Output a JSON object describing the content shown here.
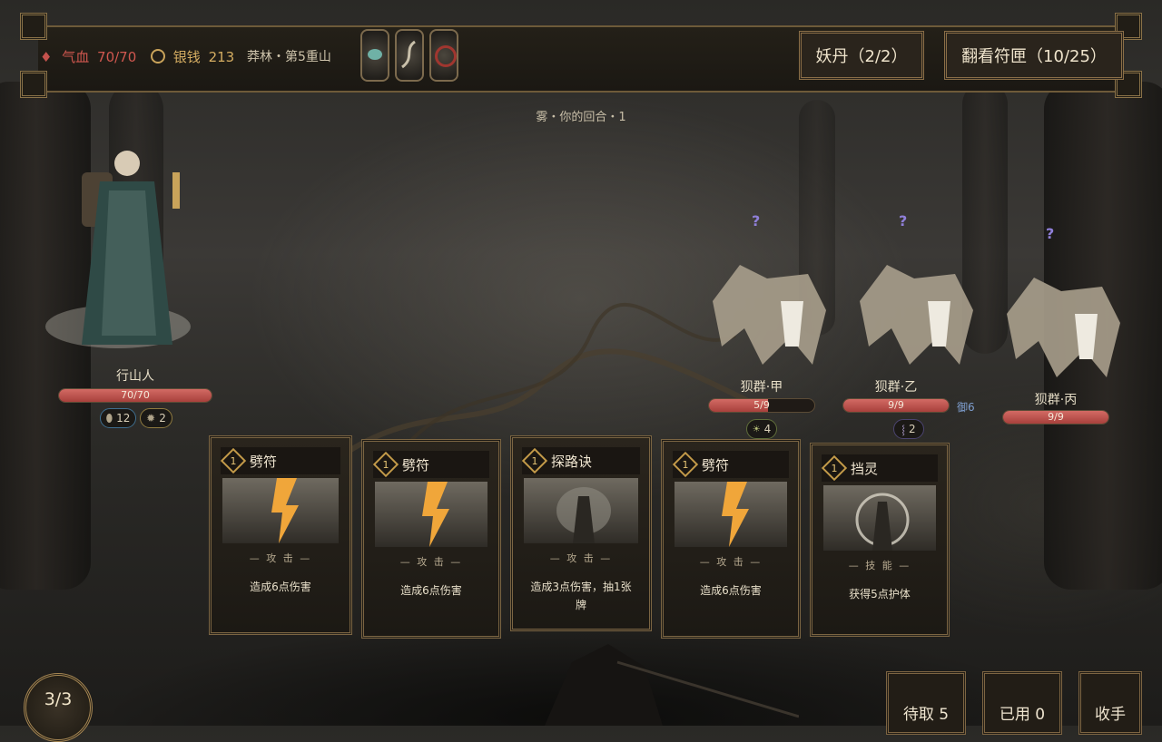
{
  "hud": {
    "hp_label": "气血",
    "hp_value": "70/70",
    "money_label": "银钱",
    "money_value": "213",
    "location": "莽林・第5重山",
    "relics": [
      "jade-bowl-relic",
      "serpent-relic",
      "red-ring-relic"
    ],
    "yaodan_button": "妖丹（2/2）",
    "talisman_box_button": "翻看符匣（10/25）"
  },
  "turn_text": "雾・你的回合・1",
  "player": {
    "name": "行山人",
    "hp": "70/70",
    "hp_fraction": 1.0,
    "status": [
      {
        "icon": "shield-icon",
        "value": "12"
      },
      {
        "icon": "gear-icon",
        "value": "2"
      }
    ]
  },
  "enemies": [
    {
      "name": "狈群·甲",
      "intent": "?",
      "hp": "5/9",
      "hp_fraction": 0.556,
      "block": "",
      "status": [
        {
          "icon": "sun-icon",
          "value": "4"
        }
      ]
    },
    {
      "name": "狈群·乙",
      "intent": "?",
      "hp": "9/9",
      "hp_fraction": 1.0,
      "block": "御6",
      "status": [
        {
          "icon": "claw-icon",
          "value": "2"
        }
      ]
    },
    {
      "name": "狈群·丙",
      "intent": "?",
      "hp": "9/9",
      "hp_fraction": 1.0,
      "block": "",
      "status": []
    }
  ],
  "hand": [
    {
      "cost": "1",
      "title": "劈符",
      "type": "— 攻 击 —",
      "desc": "造成6点伤害",
      "art": "lightning"
    },
    {
      "cost": "1",
      "title": "劈符",
      "type": "— 攻 击 —",
      "desc": "造成6点伤害",
      "art": "lightning"
    },
    {
      "cost": "1",
      "title": "探路诀",
      "type": "— 攻 击 —",
      "desc": "造成3点伤害，抽1张牌",
      "art": "figure"
    },
    {
      "cost": "1",
      "title": "劈符",
      "type": "— 攻 击 —",
      "desc": "造成6点伤害",
      "art": "lightning"
    },
    {
      "cost": "1",
      "title": "挡灵",
      "type": "— 技 能 —",
      "desc": "获得5点护体",
      "art": "orb"
    }
  ],
  "energy": "3/3",
  "buttons": {
    "draw_pile": "待取 5",
    "discard_pile": "已用 0",
    "end_turn": "收手"
  },
  "colors": {
    "hp_red": "#c4524d",
    "gold_trim": "#8a7248",
    "intent_purple": "#8f7fd8",
    "block_blue": "#7f9fd0"
  }
}
